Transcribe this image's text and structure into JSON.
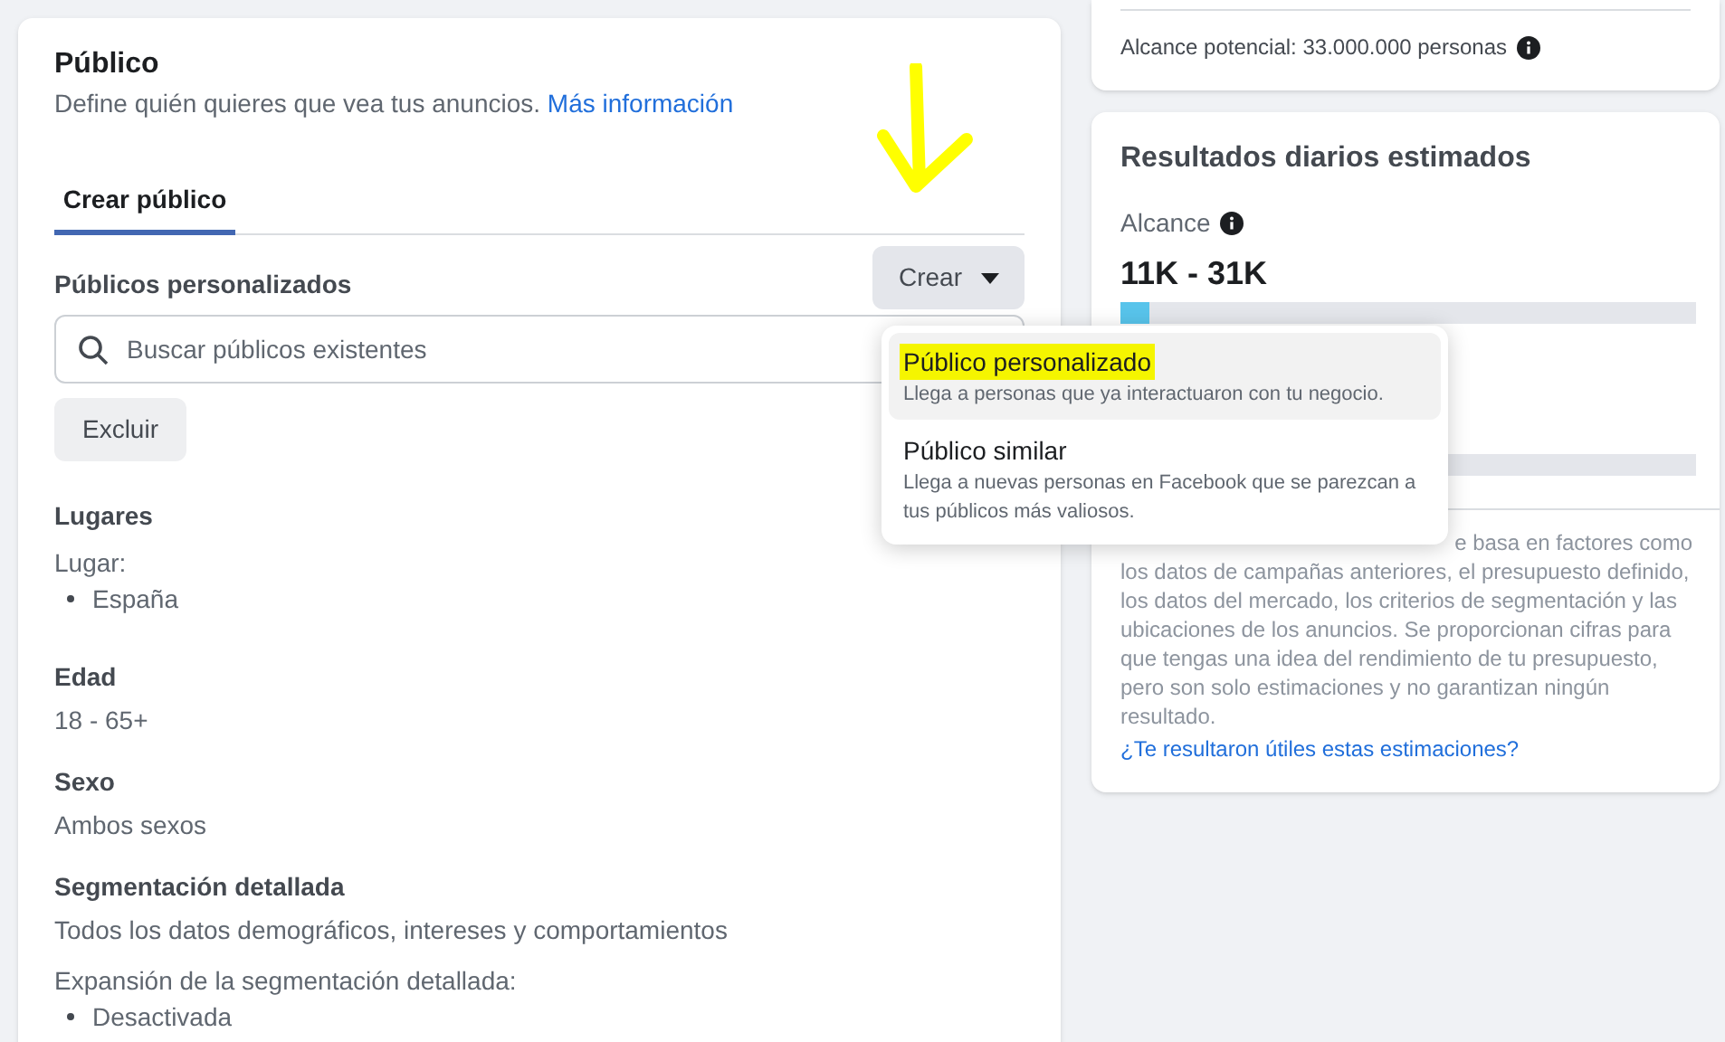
{
  "audience": {
    "title": "Público",
    "description": "Define quién quieres que vea tus anuncios.",
    "more_link": "Más información",
    "tabs": [
      {
        "label": "Crear público",
        "selected": true
      }
    ],
    "custom_audiences": {
      "label": "Públicos personalizados",
      "create_button": "Crear",
      "search": {
        "placeholder": "Buscar públicos existentes"
      },
      "exclude_button": "Excluir"
    },
    "sections": [
      {
        "title": "Lugares",
        "label": "Lugar:",
        "items": [
          "España"
        ]
      },
      {
        "title": "Edad",
        "text": "18 - 65+"
      },
      {
        "title": "Sexo",
        "text": "Ambos sexos"
      },
      {
        "title": "Segmentación detallada",
        "text": "Todos los datos demográficos, intereses y comportamientos",
        "label": "Expansión de la segmentación detallada:",
        "items": [
          "Desactivada"
        ]
      }
    ]
  },
  "create_menu": {
    "items": [
      {
        "title": "Público personalizado",
        "description": "Llega a personas que ya interactuaron con tu negocio.",
        "hovered": true,
        "highlighted": true
      },
      {
        "title": "Público similar",
        "description": "Llega a nuevas personas en Facebook que se parezcan a tus públicos más valiosos.",
        "hovered": false,
        "highlighted": false
      }
    ]
  },
  "annotation_arrow": true,
  "potential_reach": {
    "text": "Alcance potencial: 33.000.000 personas"
  },
  "daily_results": {
    "title": "Resultados diarios estimados",
    "metric": "Alcance",
    "range": "11K - 31K",
    "level": 0.05,
    "note_fragment": "e basa en factores como",
    "note": "los datos de campañas anteriores, el presupuesto definido, los datos del mercado, los criterios de segmentación y las ubicaciones de los anuncios. Se proporcionan cifras para que tengas una idea del rendimiento de tu presupuesto, pero son solo estimaciones y no garantizan ningún resultado.",
    "feedback_link": "¿Te resultaron útiles estas estimaciones?"
  }
}
